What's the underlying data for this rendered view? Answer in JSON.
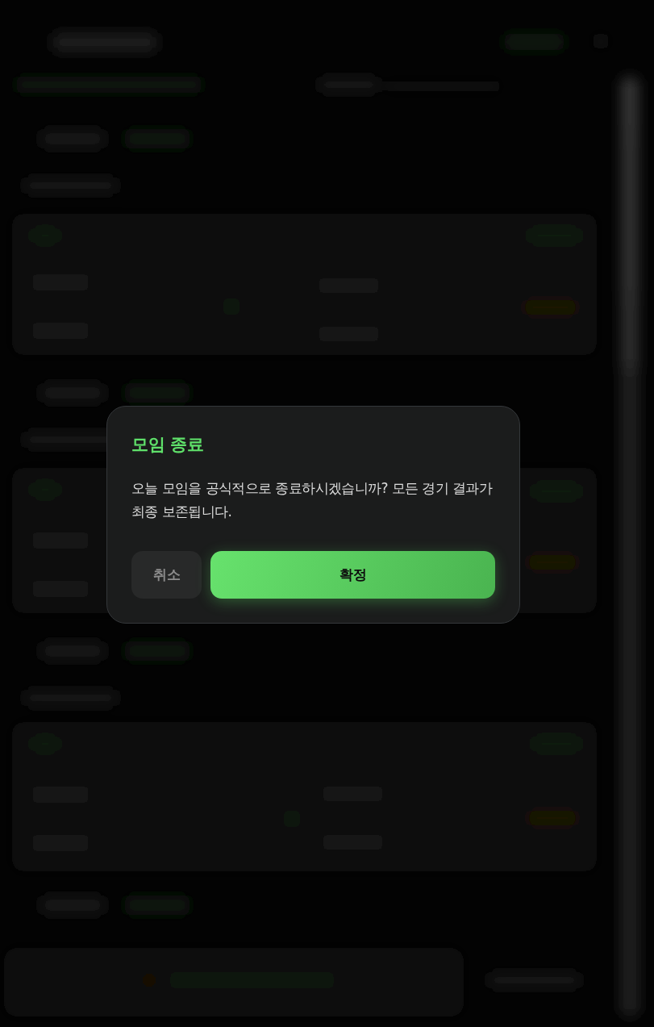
{
  "dialog": {
    "title": "모임 종료",
    "message": "오늘 모임을 공식적으로 종료하시겠습니까? 모든 경기 결과가 최종 보존됩니다.",
    "buttons": [
      {
        "label": "취소",
        "kind": "secondary"
      },
      {
        "label": "확정",
        "kind": "primary"
      }
    ]
  }
}
